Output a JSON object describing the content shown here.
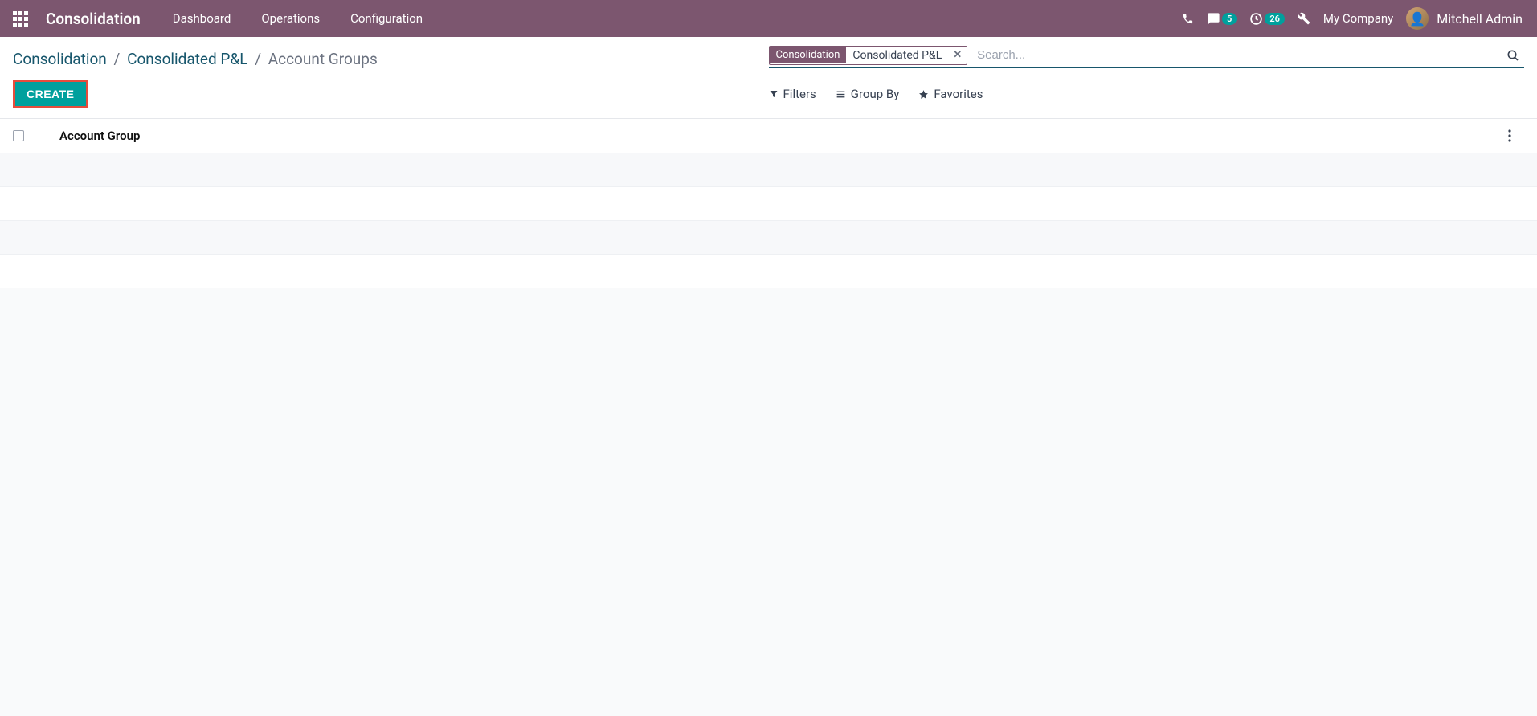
{
  "navbar": {
    "app_title": "Consolidation",
    "menu": [
      "Dashboard",
      "Operations",
      "Configuration"
    ],
    "messages_badge": "5",
    "activities_badge": "26",
    "company": "My Company",
    "user_name": "Mitchell Admin"
  },
  "breadcrumb": {
    "items": [
      "Consolidation",
      "Consolidated P&L"
    ],
    "current": "Account Groups"
  },
  "search": {
    "facet_label": "Consolidation",
    "facet_value": "Consolidated P&L",
    "placeholder": "Search...",
    "filters_label": "Filters",
    "groupby_label": "Group By",
    "favorites_label": "Favorites"
  },
  "buttons": {
    "create": "CREATE"
  },
  "table": {
    "column_header": "Account Group"
  }
}
